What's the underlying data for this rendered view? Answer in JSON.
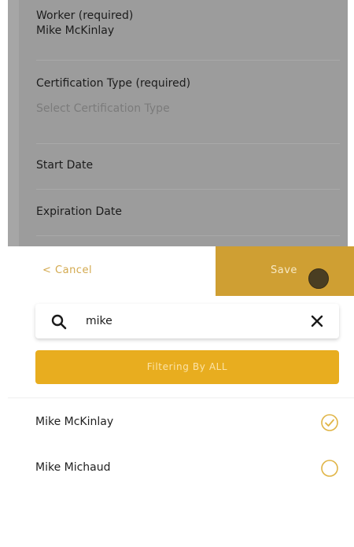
{
  "form": {
    "worker_label": "Worker (required)",
    "worker_value": "Mike McKinlay",
    "cert_label": "Certification Type (required)",
    "cert_placeholder": "Select Certification Type",
    "start_label": "Start Date",
    "expiration_label": "Expiration Date"
  },
  "sheet": {
    "cancel_label": "< Cancel",
    "save_label": "Save",
    "search": {
      "value": "mike"
    },
    "filter_label": "Filtering By ALL",
    "results": [
      {
        "name": "Mike McKinlay",
        "selected": true
      },
      {
        "name": "Mike Michaud",
        "selected": false
      }
    ]
  },
  "colors": {
    "accent": "#e8ad1f",
    "save_bg": "#cf9f33",
    "check": "#e0b445"
  },
  "icons": {
    "search": "search-icon",
    "clear": "close-icon",
    "selected": "check-circle-icon",
    "unselected": "empty-circle-icon"
  }
}
